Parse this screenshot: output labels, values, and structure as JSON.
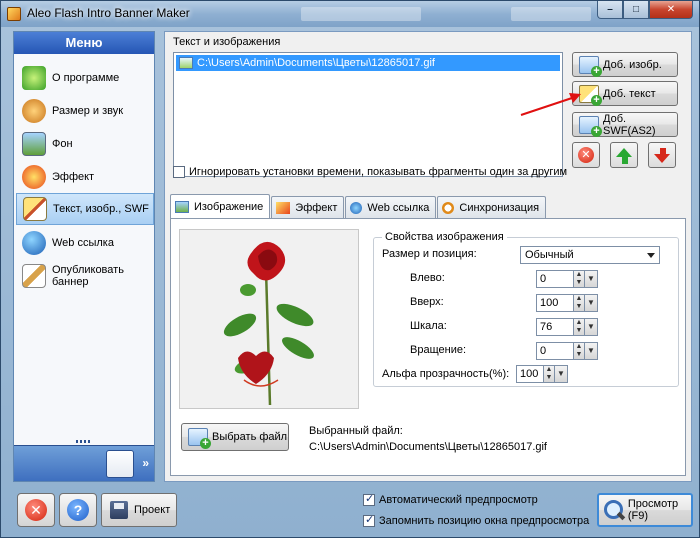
{
  "window": {
    "title": "Aleo Flash Intro Banner Maker",
    "controls": {
      "minimize": "–",
      "maximize": "□",
      "close": "✕"
    }
  },
  "menu": {
    "header": "Меню",
    "items": [
      {
        "label": "О программе",
        "icon": "home-icon"
      },
      {
        "label": "Размер и звук",
        "icon": "palette-icon"
      },
      {
        "label": "Фон",
        "icon": "picture-icon"
      },
      {
        "label": "Эффект",
        "icon": "sparkle-icon"
      },
      {
        "label": "Текст, изобр., SWF",
        "icon": "pencil-icon"
      },
      {
        "label": "Web ссылка",
        "icon": "globe-icon"
      },
      {
        "label": "Опубликовать баннер",
        "icon": "publish-icon"
      }
    ],
    "active_index": 4,
    "footer_chevron": "»"
  },
  "content": {
    "section_title": "Текст и изображения",
    "files": [
      {
        "path": "C:\\Users\\Admin\\Documents\\Цветы\\12865017.gif"
      }
    ],
    "buttons": {
      "add_image": "Доб. изобр.",
      "add_text": "Доб. текст",
      "add_swf": "Доб. SWF(AS2)"
    },
    "ignore_timing": {
      "label": "Игнорировать установки времени, показывать фрагменты один за другим",
      "checked": false
    },
    "tabs": [
      {
        "label": "Изображение",
        "icon": "image-icon"
      },
      {
        "label": "Эффект",
        "icon": "wand-icon"
      },
      {
        "label": "Web ссылка",
        "icon": "globe-icon"
      },
      {
        "label": "Синхронизация",
        "icon": "clock-icon"
      }
    ],
    "active_tab": 0,
    "image_panel": {
      "properties_title": "Свойства изображения",
      "size_position_label": "Размер и позиция:",
      "size_position_value": "Обычный",
      "left_label": "Влево:",
      "left_value": "0",
      "top_label": "Вверх:",
      "top_value": "100",
      "scale_label": "Шкала:",
      "scale_value": "76",
      "rotation_label": "Вращение:",
      "rotation_value": "0",
      "alpha_label": "Альфа прозрачность(%):",
      "alpha_value": "100",
      "choose_file_button": "Выбрать файл",
      "selected_file_label": "Выбранный файл:",
      "selected_file_path": "C:\\Users\\Admin\\Documents\\Цветы\\12865017.gif"
    }
  },
  "bottom": {
    "project_button": "Проект",
    "auto_preview": {
      "label": "Автоматический предпросмотр",
      "checked": true
    },
    "remember_position": {
      "label": "Запомнить позицию окна предпросмотра",
      "checked": true
    },
    "preview_button": "Просмотр (F9)"
  },
  "colors": {
    "accent": "#3399ff",
    "menu_header": "#2556b4",
    "annotation_arrow": "#e01010"
  }
}
